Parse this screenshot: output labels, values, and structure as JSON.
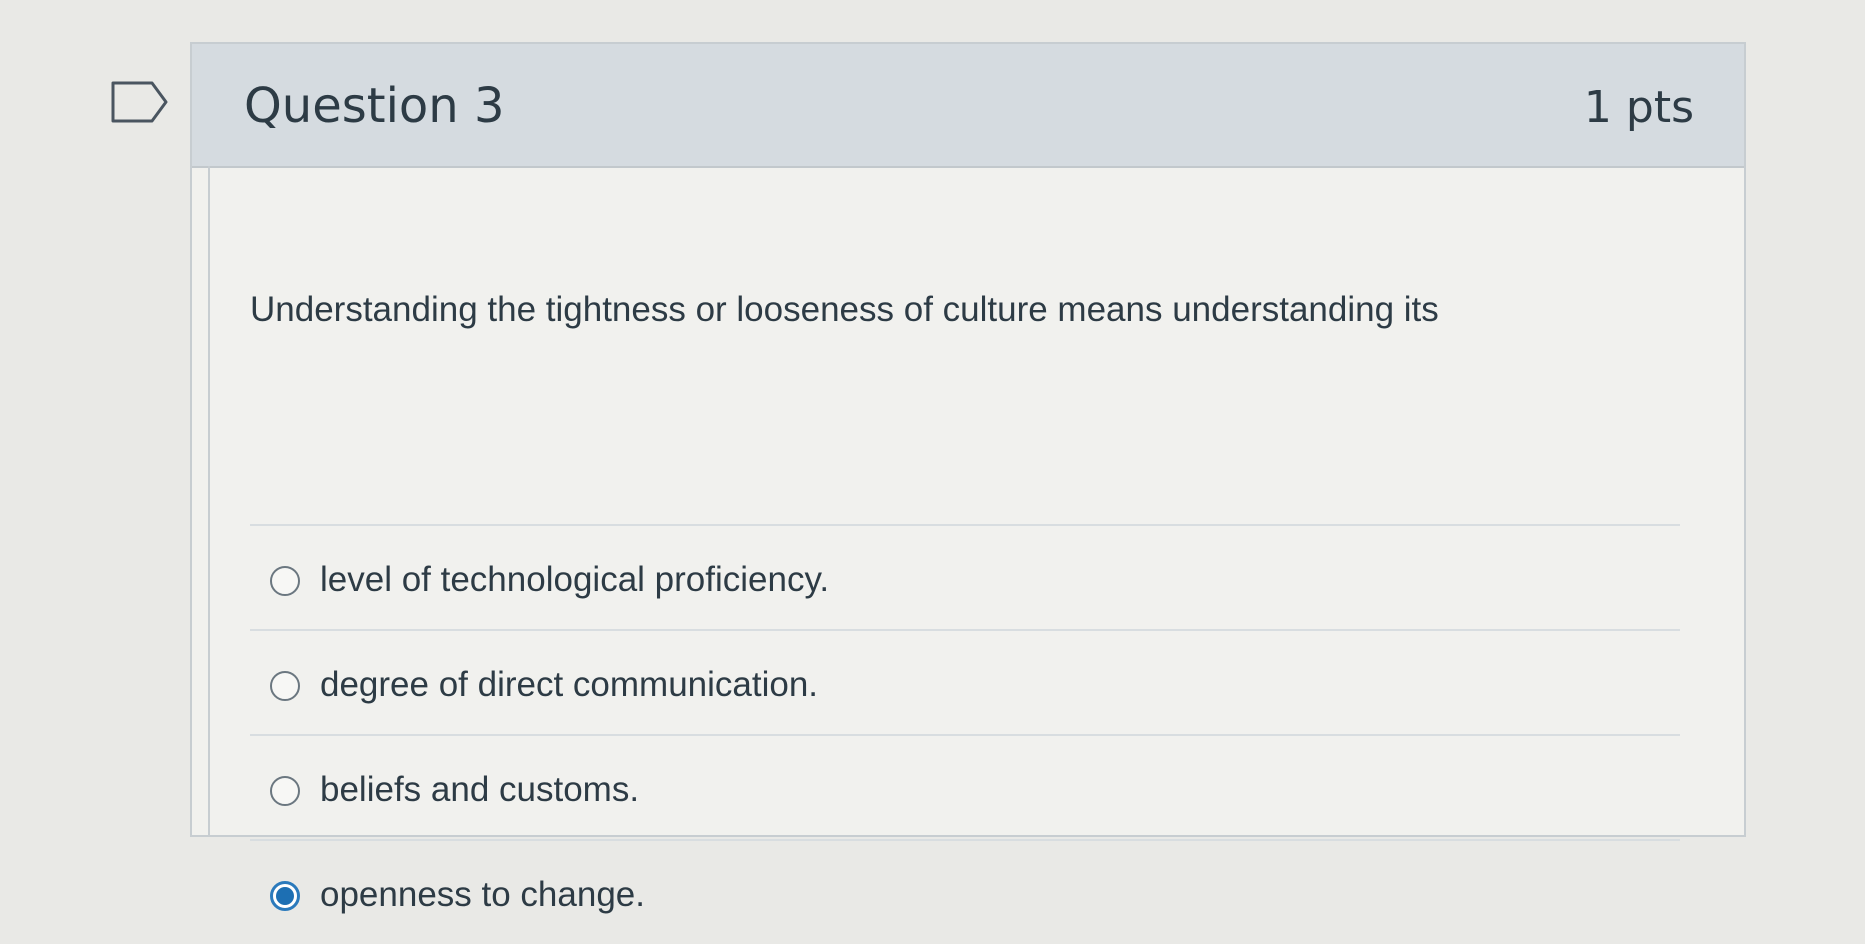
{
  "question": {
    "title": "Question 3",
    "points": "1 pts",
    "text": "Understanding the tightness or looseness of culture means understanding its",
    "flag_icon": "flag-outline-icon"
  },
  "answers": [
    {
      "label": "level of technological proficiency.",
      "selected": false
    },
    {
      "label": "degree of direct communication.",
      "selected": false
    },
    {
      "label": "beliefs and customs.",
      "selected": false
    },
    {
      "label": "openness to change.",
      "selected": true
    }
  ],
  "colors": {
    "header_bg": "#d5dbe0",
    "selected_radio": "#1d6fb3",
    "text": "#2d3b45"
  }
}
